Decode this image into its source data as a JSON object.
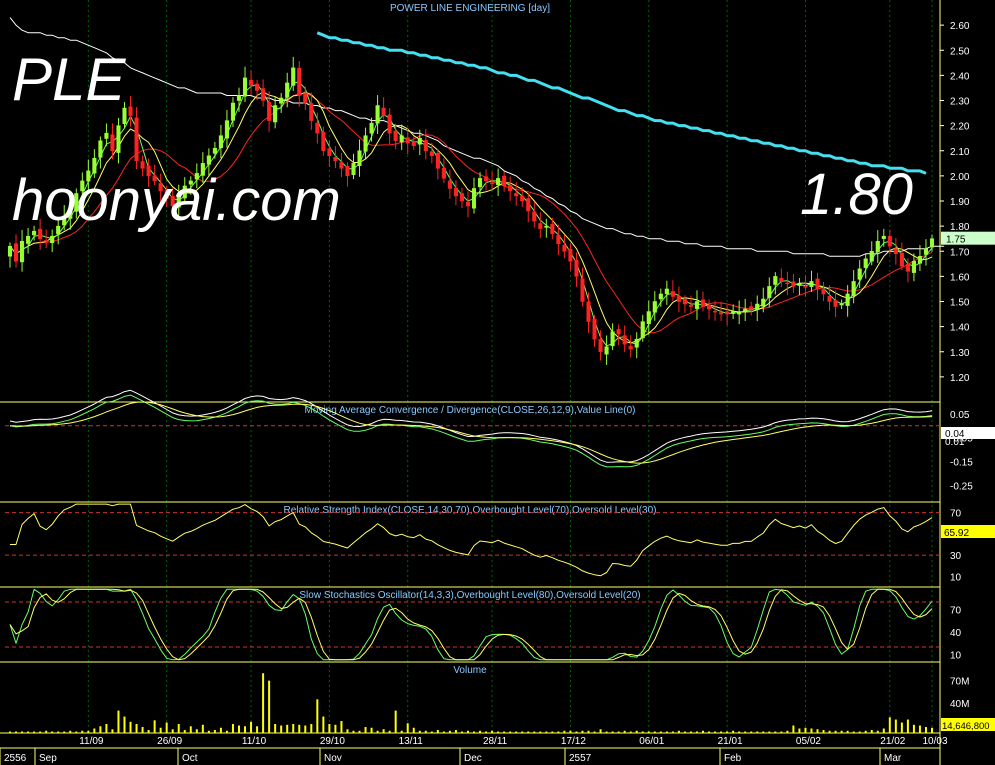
{
  "watermark": {
    "symbol": "PLE",
    "site": "hoonyai.com",
    "price": "1.80"
  },
  "colors": {
    "bg": "#000000",
    "bull": "#99ff33",
    "bear": "#ff2222",
    "ma_red": "#ff2222",
    "ma_yellow": "#ffff66",
    "ma_green": "#66ff66",
    "ma_white": "#ffffff",
    "ma_cyan": "#44e0f0",
    "title": "#88c8ff",
    "grid": "#006600",
    "axis_text": "#ffffff",
    "dash": "#cc3333",
    "volume": "#ffff00",
    "sep": "#ffff66",
    "last_box": "#ccffcc",
    "label_box": "#ffff00"
  },
  "chart_data": [
    {
      "id": "price",
      "type": "candlestick",
      "title": "POWER LINE ENGINEERING [day]",
      "ylim": [
        1.1,
        2.7
      ],
      "yticks": [
        1.2,
        1.3,
        1.4,
        1.5,
        1.6,
        1.7,
        1.8,
        1.9,
        2.0,
        2.1,
        2.2,
        2.3,
        2.4,
        2.5,
        2.6
      ],
      "ytick_labels": [
        "1.20",
        "1.30",
        "1.40",
        "1.50",
        "1.60",
        "1.70",
        "1.80",
        "1.90",
        "2.00",
        "2.10",
        "2.20",
        "2.30",
        "2.40",
        "2.50",
        "2.60"
      ],
      "last_label": "1.75",
      "close": [
        1.72,
        1.66,
        1.74,
        1.76,
        1.78,
        1.75,
        1.74,
        1.76,
        1.8,
        1.84,
        1.86,
        1.93,
        1.98,
        2.02,
        2.07,
        2.14,
        2.17,
        2.1,
        2.2,
        2.27,
        2.24,
        2.06,
        2.03,
        2.0,
        1.98,
        1.94,
        1.91,
        1.88,
        1.92,
        1.96,
        1.98,
        2.01,
        2.05,
        2.08,
        2.11,
        2.16,
        2.22,
        2.29,
        2.32,
        2.39,
        2.36,
        2.34,
        2.3,
        2.22,
        2.28,
        2.31,
        2.37,
        2.43,
        2.32,
        2.29,
        2.22,
        2.17,
        2.1,
        2.08,
        2.06,
        2.03,
        2.0,
        2.05,
        2.1,
        2.16,
        2.21,
        2.28,
        2.24,
        2.17,
        2.14,
        2.16,
        2.13,
        2.12,
        2.15,
        2.1,
        2.08,
        2.03,
        1.99,
        1.95,
        1.92,
        1.9,
        1.88,
        1.95,
        1.99,
        1.98,
        1.97,
        1.99,
        1.96,
        1.94,
        1.92,
        1.9,
        1.86,
        1.82,
        1.79,
        1.8,
        1.77,
        1.73,
        1.7,
        1.66,
        1.6,
        1.5,
        1.42,
        1.35,
        1.3,
        1.32,
        1.38,
        1.37,
        1.33,
        1.31,
        1.35,
        1.42,
        1.46,
        1.5,
        1.53,
        1.55,
        1.52,
        1.5,
        1.49,
        1.48,
        1.5,
        1.48,
        1.47,
        1.46,
        1.45,
        1.45,
        1.46,
        1.46,
        1.47,
        1.47,
        1.49,
        1.51,
        1.56,
        1.6,
        1.58,
        1.57,
        1.56,
        1.57,
        1.56,
        1.58,
        1.55,
        1.53,
        1.5,
        1.48,
        1.49,
        1.53,
        1.58,
        1.63,
        1.67,
        1.7,
        1.74,
        1.76,
        1.72,
        1.69,
        1.64,
        1.62,
        1.66,
        1.68,
        1.71,
        1.75
      ],
      "overlays": [
        {
          "name": "white",
          "values": [
            2.63,
            2.6,
            2.58,
            2.57,
            2.57,
            2.57,
            2.56,
            2.56,
            2.55,
            2.55,
            2.54,
            2.54,
            2.53,
            2.52,
            2.51,
            2.5,
            2.49,
            2.47,
            2.46,
            2.45,
            2.43,
            2.42,
            2.41,
            2.4,
            2.39,
            2.38,
            2.37,
            2.36,
            2.35,
            2.35,
            2.34,
            2.33,
            2.33,
            2.33,
            2.33,
            2.33,
            2.32,
            2.32,
            2.32,
            2.32,
            2.32,
            2.31,
            2.31,
            2.31,
            2.3,
            2.3,
            2.3,
            2.29,
            2.29,
            2.29,
            2.28,
            2.28,
            2.27,
            2.27,
            2.26,
            2.26,
            2.25,
            2.24,
            2.23,
            2.23,
            2.22,
            2.22,
            2.22,
            2.21,
            2.2,
            2.19,
            2.18,
            2.17,
            2.17,
            2.16,
            2.15,
            2.14,
            2.12,
            2.11,
            2.1,
            2.09,
            2.08,
            2.07,
            2.07,
            2.06,
            2.05,
            2.04,
            2.02,
            2.01,
            2.0,
            1.98,
            1.97,
            1.95,
            1.94,
            1.92,
            1.91,
            1.89,
            1.88,
            1.86,
            1.85,
            1.83,
            1.82,
            1.81,
            1.8,
            1.79,
            1.79,
            1.78,
            1.77,
            1.77,
            1.76,
            1.76,
            1.75,
            1.75,
            1.75,
            1.74,
            1.74,
            1.74,
            1.73,
            1.73,
            1.73,
            1.72,
            1.72,
            1.72,
            1.72,
            1.71,
            1.71,
            1.71,
            1.71,
            1.71,
            1.7,
            1.7,
            1.7,
            1.7,
            1.7,
            1.7,
            1.69,
            1.69,
            1.69,
            1.69,
            1.69,
            1.69,
            1.68,
            1.68,
            1.68,
            1.68,
            1.68,
            1.68,
            1.69,
            1.69,
            1.69,
            1.7,
            1.7,
            1.7,
            1.7,
            1.71,
            1.71,
            1.71,
            1.71,
            1.72,
            1.72,
            1.72
          ]
        },
        {
          "name": "cyan",
          "start": 51,
          "values": [
            2.57,
            2.56,
            2.55,
            2.55,
            2.54,
            2.54,
            2.53,
            2.53,
            2.52,
            2.52,
            2.51,
            2.51,
            2.5,
            2.5,
            2.5,
            2.49,
            2.49,
            2.48,
            2.48,
            2.47,
            2.47,
            2.46,
            2.46,
            2.45,
            2.45,
            2.44,
            2.44,
            2.43,
            2.43,
            2.42,
            2.41,
            2.41,
            2.4,
            2.4,
            2.39,
            2.38,
            2.38,
            2.37,
            2.36,
            2.35,
            2.35,
            2.34,
            2.33,
            2.32,
            2.31,
            2.31,
            2.3,
            2.29,
            2.28,
            2.27,
            2.26,
            2.26,
            2.25,
            2.24,
            2.24,
            2.23,
            2.22,
            2.22,
            2.21,
            2.21,
            2.2,
            2.2,
            2.19,
            2.19,
            2.18,
            2.18,
            2.17,
            2.17,
            2.16,
            2.16,
            2.15,
            2.15,
            2.14,
            2.14,
            2.13,
            2.13,
            2.12,
            2.12,
            2.11,
            2.11,
            2.1,
            2.1,
            2.09,
            2.09,
            2.08,
            2.08,
            2.07,
            2.07,
            2.06,
            2.06,
            2.05,
            2.05,
            2.04,
            2.04,
            2.04,
            2.03,
            2.03,
            2.03,
            2.02,
            2.02,
            2.02,
            2.01
          ]
        }
      ]
    },
    {
      "id": "macd",
      "type": "line",
      "title": "Moving Average Convergence / Divergence(CLOSE,26,12,9),Value Line(0)",
      "ylim": [
        -0.32,
        0.1
      ],
      "yticks": [
        0.05,
        -0.05,
        -0.15,
        -0.25
      ],
      "ytick_labels": [
        "0.05",
        "-0.05",
        "-0.15",
        "-0.25"
      ],
      "reference": [
        0.0
      ],
      "labels": [
        "0.04",
        "0.01"
      ]
    },
    {
      "id": "rsi",
      "type": "line",
      "title": "Relative Strength Index(CLOSE,14,30,70),Overbought Level(70),Oversold Level(30)",
      "ylim": [
        0,
        80
      ],
      "yticks": [
        70,
        50,
        30,
        10
      ],
      "ytick_labels": [
        "70",
        "50",
        "30",
        "10"
      ],
      "reference": [
        70,
        30
      ],
      "label": "65.92"
    },
    {
      "id": "stoch",
      "type": "line",
      "title": "Slow Stochastics Oscillator(14,3,3),Overbought Level(80),Oversold Level(20)",
      "ylim": [
        0,
        100
      ],
      "yticks": [
        70,
        40,
        10
      ],
      "ytick_labels": [
        "70",
        "40",
        "10"
      ],
      "reference": [
        80,
        20
      ]
    },
    {
      "id": "volume",
      "type": "bar",
      "title": "Volume",
      "ylim": [
        0,
        95000000
      ],
      "yticks": [
        70000000,
        40000000
      ],
      "ytick_labels": [
        "70M",
        "40M"
      ],
      "label": "14,646,800",
      "values": [
        2,
        2,
        2,
        2,
        2,
        2,
        3,
        2,
        2,
        2,
        3,
        2,
        3,
        3,
        6,
        9,
        12,
        5,
        30,
        22,
        15,
        12,
        8,
        4,
        17,
        7,
        14,
        5,
        12,
        4,
        9,
        5,
        11,
        3,
        4,
        7,
        3,
        12,
        10,
        9,
        15,
        9,
        80,
        70,
        12,
        10,
        11,
        12,
        11,
        10,
        12,
        45,
        22,
        12,
        11,
        16,
        5,
        3,
        3,
        8,
        7,
        3,
        5,
        3,
        30,
        3,
        13,
        7,
        3,
        3,
        2,
        4,
        2,
        3,
        4,
        2,
        3,
        2,
        3,
        2,
        3,
        2,
        2,
        2,
        2,
        2,
        2,
        2,
        2,
        2,
        2,
        2,
        3,
        3,
        2,
        3,
        3,
        2,
        5,
        2,
        2,
        2,
        3,
        2,
        3,
        2,
        2,
        2,
        2,
        2,
        2,
        3,
        2,
        2,
        2,
        3,
        2,
        2,
        2,
        2,
        3,
        2,
        2,
        2,
        2,
        2,
        2,
        2,
        2,
        3,
        10,
        6,
        7,
        6,
        5,
        4,
        3,
        3,
        3,
        3,
        2,
        2,
        3,
        4,
        3,
        6,
        21,
        18,
        14,
        18,
        11,
        10,
        8,
        7,
        13,
        12,
        14,
        6
      ]
    }
  ],
  "x_axis": {
    "dates": [
      "11/09",
      "26/09",
      "11/10",
      "29/10",
      "13/11",
      "28/11",
      "17/12",
      "06/01",
      "21/01",
      "05/02",
      "21/02",
      "10/03"
    ],
    "months": [
      "2556",
      "Sep",
      "Oct",
      "Nov",
      "Dec",
      "2557",
      "Feb",
      "Mar"
    ]
  }
}
